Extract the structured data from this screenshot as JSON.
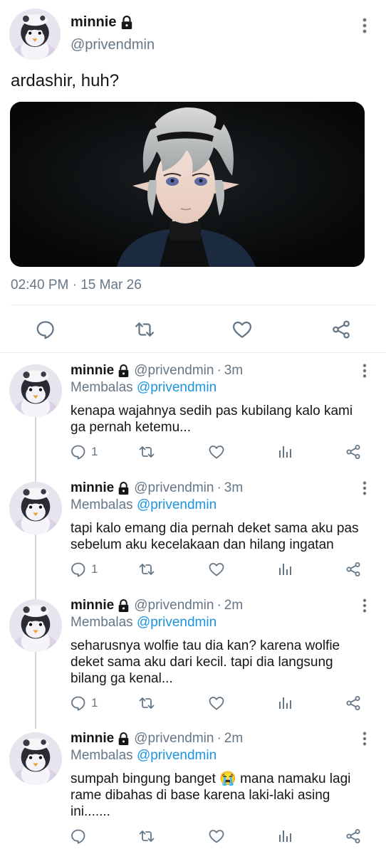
{
  "main_tweet": {
    "author_name": "minnie",
    "author_handle": "@privendmin",
    "text": "ardashir, huh?",
    "timestamp": "02:40 PM · 15 Mar 26",
    "icons": {
      "more": "more-vertical-icon",
      "lock": "lock-icon",
      "reply": "reply-icon",
      "retweet": "retweet-icon",
      "like": "like-icon",
      "share": "share-icon"
    }
  },
  "replies": [
    {
      "name": "minnie",
      "handle": "@privendmin",
      "separator": "·",
      "time": "3m",
      "replying_prefix": "Membalas",
      "replying_to": "@privendmin",
      "text": "kenapa wajahnya sedih pas kubilang kalo kami ga pernah ketemu...",
      "reply_count": "1"
    },
    {
      "name": "minnie",
      "handle": "@privendmin",
      "separator": "·",
      "time": "3m",
      "replying_prefix": "Membalas",
      "replying_to": "@privendmin",
      "text": "tapi kalo emang dia pernah deket sama aku pas sebelum aku kecelakaan dan hilang ingatan",
      "reply_count": "1"
    },
    {
      "name": "minnie",
      "handle": "@privendmin",
      "separator": "·",
      "time": "2m",
      "replying_prefix": "Membalas",
      "replying_to": "@privendmin",
      "text": "seharusnya wolfie tau dia kan? karena wolfie deket sama aku dari kecil. tapi dia langsung bilang ga kenal...",
      "reply_count": "1"
    },
    {
      "name": "minnie",
      "handle": "@privendmin",
      "separator": "·",
      "time": "2m",
      "replying_prefix": "Membalas",
      "replying_to": "@privendmin",
      "text": "sumpah bingung banget 😭 mana namaku lagi rame dibahas di base karena laki-laki asing ini.......",
      "reply_count": ""
    }
  ],
  "colors": {
    "text": "#14171a",
    "secondary": "#657786",
    "link": "#1b95e0",
    "divider": "#e6ecf0",
    "thread_line": "#ccd6dd"
  }
}
